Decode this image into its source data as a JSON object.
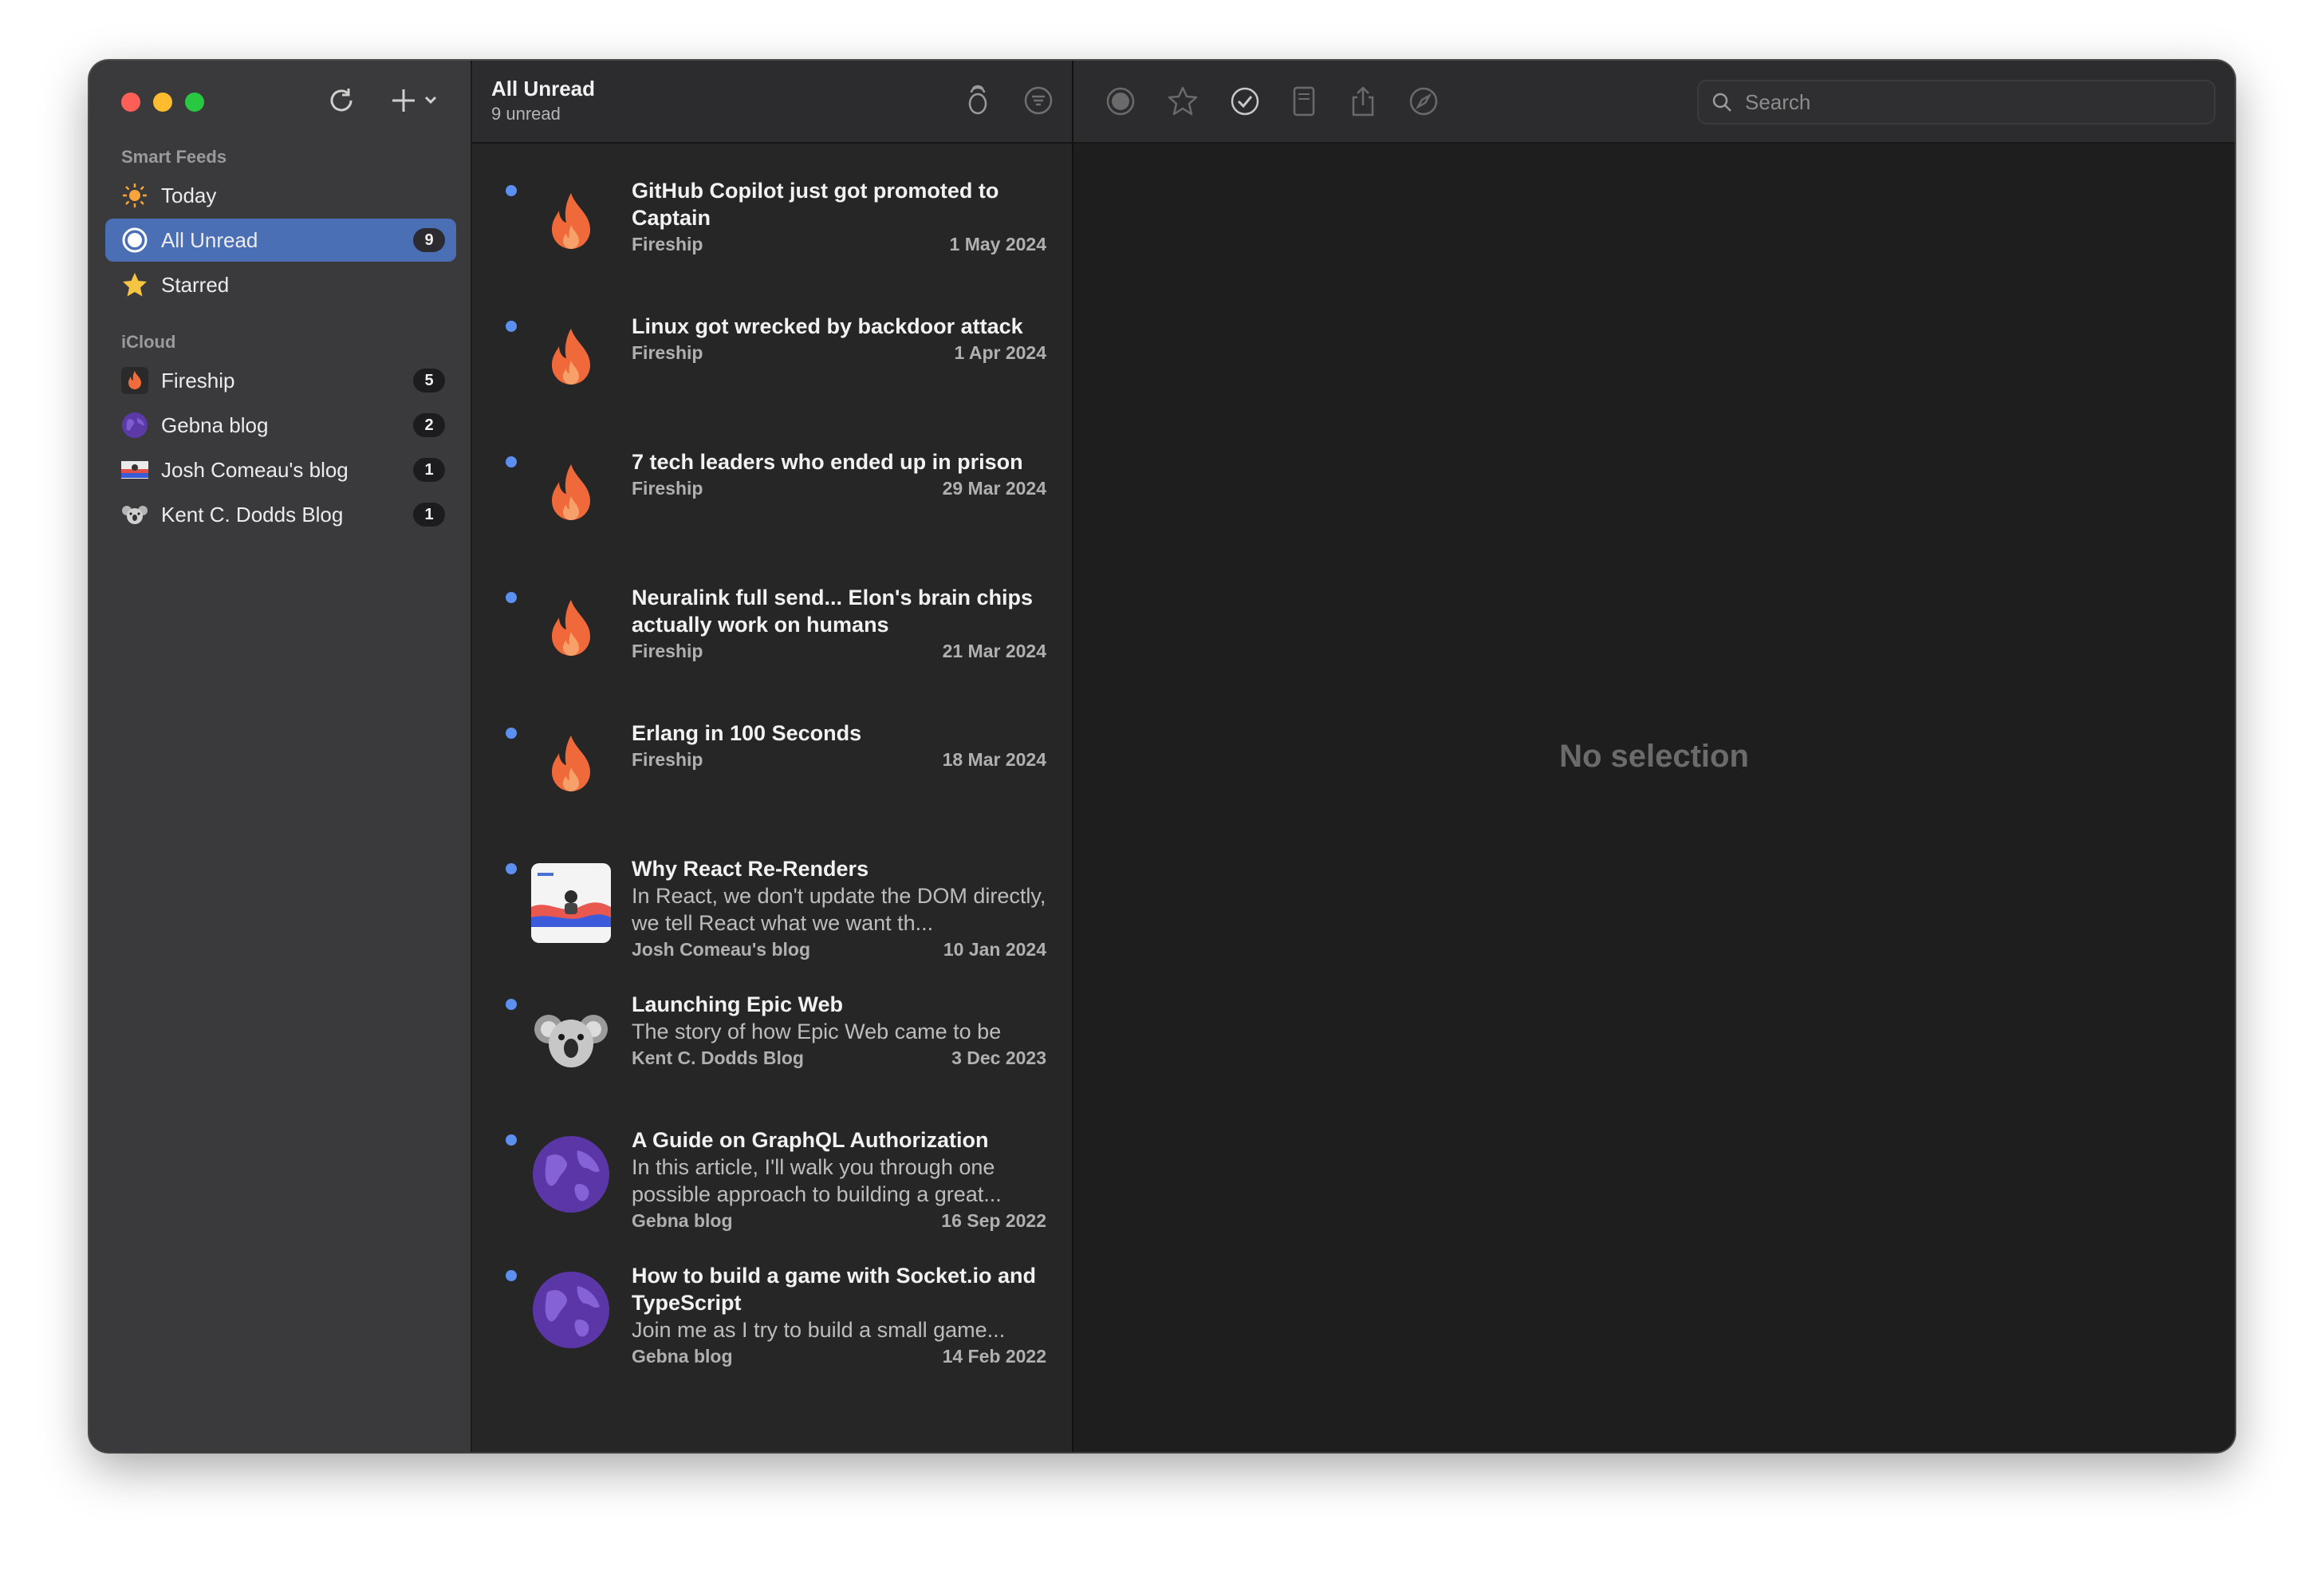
{
  "colors": {
    "accent": "#4a6fb5",
    "unread_dot": "#5b8ff0",
    "close": "#ff5f57",
    "minimize": "#febc2e",
    "zoom": "#28c840"
  },
  "sidebar": {
    "smart_feeds_label": "Smart Feeds",
    "icloud_label": "iCloud",
    "smart_items": [
      {
        "label": "Today",
        "icon": "sun-icon",
        "badge": ""
      },
      {
        "label": "All Unread",
        "icon": "unread-circle-icon",
        "badge": "9",
        "selected": true
      },
      {
        "label": "Starred",
        "icon": "star-icon",
        "badge": ""
      }
    ],
    "feeds": [
      {
        "label": "Fireship",
        "icon": "fireship-icon",
        "badge": "5"
      },
      {
        "label": "Gebna blog",
        "icon": "globe-icon",
        "badge": "2"
      },
      {
        "label": "Josh Comeau's blog",
        "icon": "josh-comeau-icon",
        "badge": "1"
      },
      {
        "label": "Kent C. Dodds Blog",
        "icon": "koala-icon",
        "badge": "1"
      }
    ]
  },
  "list": {
    "title": "All Unread",
    "subtitle": "9 unread",
    "articles": [
      {
        "title": "GitHub Copilot just got promoted to Captain",
        "excerpt": "",
        "source": "Fireship",
        "date": "1 May 2024",
        "thumb": "fireship"
      },
      {
        "title": "Linux got wrecked by backdoor attack",
        "excerpt": "",
        "source": "Fireship",
        "date": "1 Apr 2024",
        "thumb": "fireship"
      },
      {
        "title": "7 tech leaders who ended up in prison",
        "excerpt": "",
        "source": "Fireship",
        "date": "29 Mar 2024",
        "thumb": "fireship"
      },
      {
        "title": "Neuralink full send... Elon's brain chips actually work on humans",
        "excerpt": "",
        "source": "Fireship",
        "date": "21 Mar 2024",
        "thumb": "fireship"
      },
      {
        "title": "Erlang in 100 Seconds",
        "excerpt": "",
        "source": "Fireship",
        "date": "18 Mar 2024",
        "thumb": "fireship"
      },
      {
        "title": "Why React Re-Renders",
        "excerpt": "In React, we don't update the DOM directly, we tell React what we want th...",
        "source": "Josh Comeau's blog",
        "date": "10 Jan 2024",
        "thumb": "josh"
      },
      {
        "title": "Launching Epic Web",
        "excerpt": "The story of how Epic Web came to be",
        "source": "Kent C. Dodds Blog",
        "date": "3 Dec 2023",
        "thumb": "koala"
      },
      {
        "title": "A Guide on GraphQL Authorization",
        "excerpt": "In this article, I'll walk you through one possible approach to building a great...",
        "source": "Gebna blog",
        "date": "16 Sep 2022",
        "thumb": "globe"
      },
      {
        "title": "How to build a game with Socket.io and TypeScript",
        "excerpt": "Join me as I try to build a small game...",
        "source": "Gebna blog",
        "date": "14 Feb 2022",
        "thumb": "globe"
      }
    ]
  },
  "reader": {
    "search_placeholder": "Search",
    "empty_text": "No selection"
  }
}
